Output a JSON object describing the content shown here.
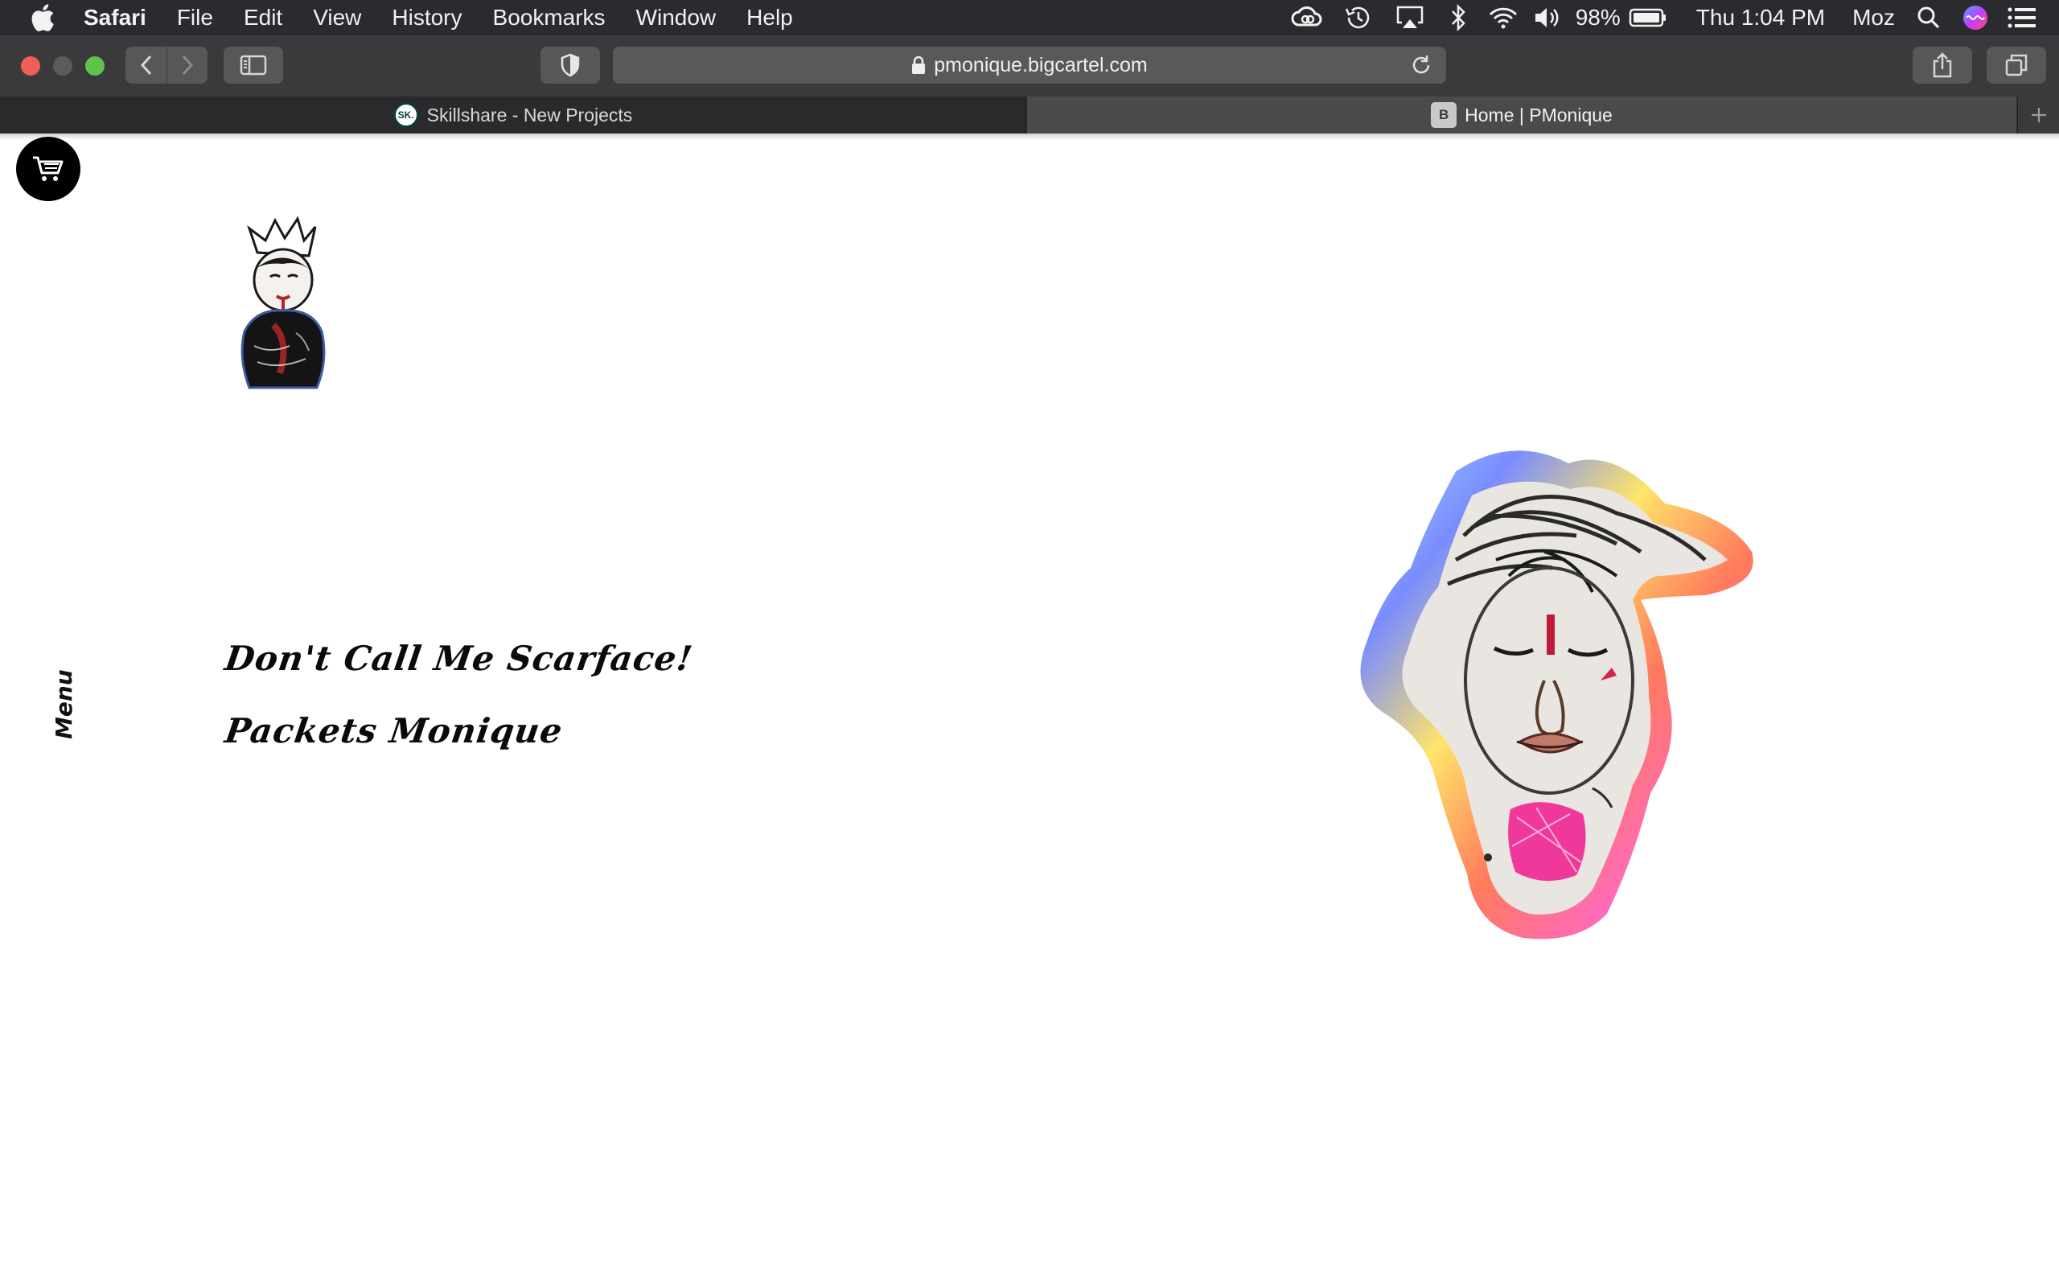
{
  "menubar": {
    "app_name": "Safari",
    "items": [
      "File",
      "Edit",
      "View",
      "History",
      "Bookmarks",
      "Window",
      "Help"
    ],
    "battery_percent": "98%",
    "clock": "Thu 1:04 PM",
    "user": "Moz",
    "status_icons": [
      "creative-cloud-icon",
      "time-machine-icon",
      "airplay-icon",
      "bluetooth-icon",
      "wifi-icon",
      "volume-icon",
      "battery-icon",
      "spotlight-icon",
      "siri-icon",
      "notification-center-icon"
    ]
  },
  "toolbar": {
    "url": "pmonique.bigcartel.com"
  },
  "tabs": [
    {
      "title": "Skillshare - New Projects",
      "favicon": "SK."
    },
    {
      "title": "Home | PMonique",
      "favicon": "B"
    }
  ],
  "page": {
    "menu_label": "Menu",
    "product_title": "Don't Call Me Scarface!",
    "shop_name": "Packets Monique"
  }
}
